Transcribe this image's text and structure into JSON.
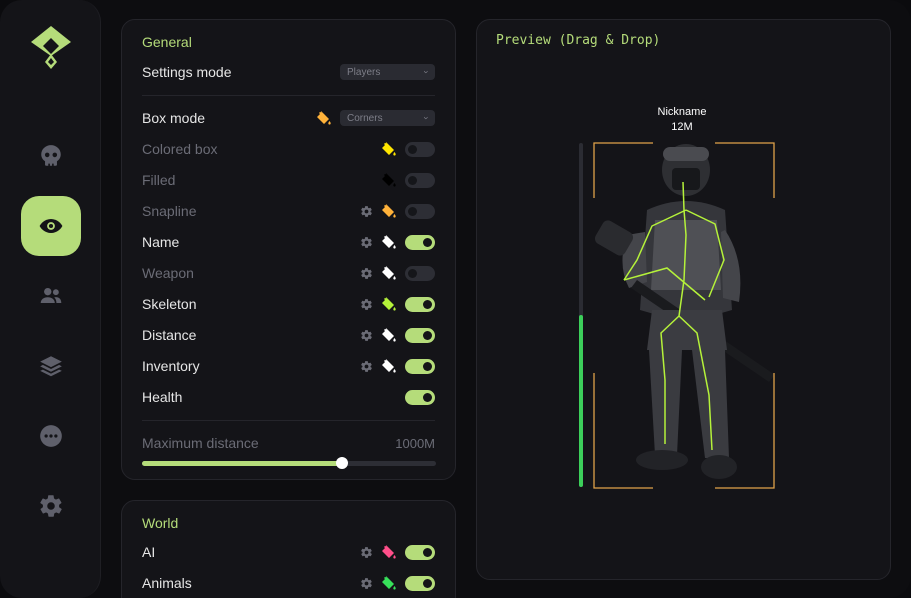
{
  "sidebar": {
    "items": [
      {
        "icon": "skull-icon",
        "active": false
      },
      {
        "icon": "eye-icon",
        "active": true
      },
      {
        "icon": "users-icon",
        "active": false
      },
      {
        "icon": "layers-icon",
        "active": false
      },
      {
        "icon": "chat-bubble-icon",
        "active": false
      },
      {
        "icon": "gear-icon",
        "active": false
      }
    ]
  },
  "general": {
    "title": "General",
    "settings_mode": {
      "label": "Settings mode",
      "value": "Players"
    },
    "box_mode": {
      "label": "Box mode",
      "value": "Corners"
    },
    "rows": [
      {
        "label": "Colored box",
        "enabled": false,
        "color": "#ffe600"
      },
      {
        "label": "Filled",
        "enabled": false,
        "color": "#000000"
      },
      {
        "label": "Snapline",
        "enabled": false,
        "color": "#ffb23a"
      },
      {
        "label": "Name",
        "enabled": true,
        "color": "#ffffff"
      },
      {
        "label": "Weapon",
        "enabled": false,
        "color": "#ffffff"
      },
      {
        "label": "Skeleton",
        "enabled": true,
        "color": "#b5f23a"
      },
      {
        "label": "Distance",
        "enabled": true,
        "color": "#ffffff"
      },
      {
        "label": "Inventory",
        "enabled": true,
        "color": "#ffffff"
      },
      {
        "label": "Health",
        "enabled": true
      }
    ],
    "max_distance": {
      "label": "Maximum distance",
      "value": "1000M",
      "fraction": 0.68
    }
  },
  "world": {
    "title": "World",
    "rows": [
      {
        "label": "AI",
        "enabled": true,
        "color": "#ff4f8a"
      },
      {
        "label": "Animals",
        "enabled": true,
        "color": "#37e05a"
      }
    ]
  },
  "preview": {
    "title": "Preview (Drag & Drop)",
    "nickname": "Nickname",
    "distance": "12M",
    "health_fraction": 0.5,
    "box_color": "#e0a24a",
    "skeleton_color": "#b5f23a"
  },
  "colors": {
    "accent": "#b5dc7a",
    "box_mode_bucket": "#ffb23a"
  }
}
